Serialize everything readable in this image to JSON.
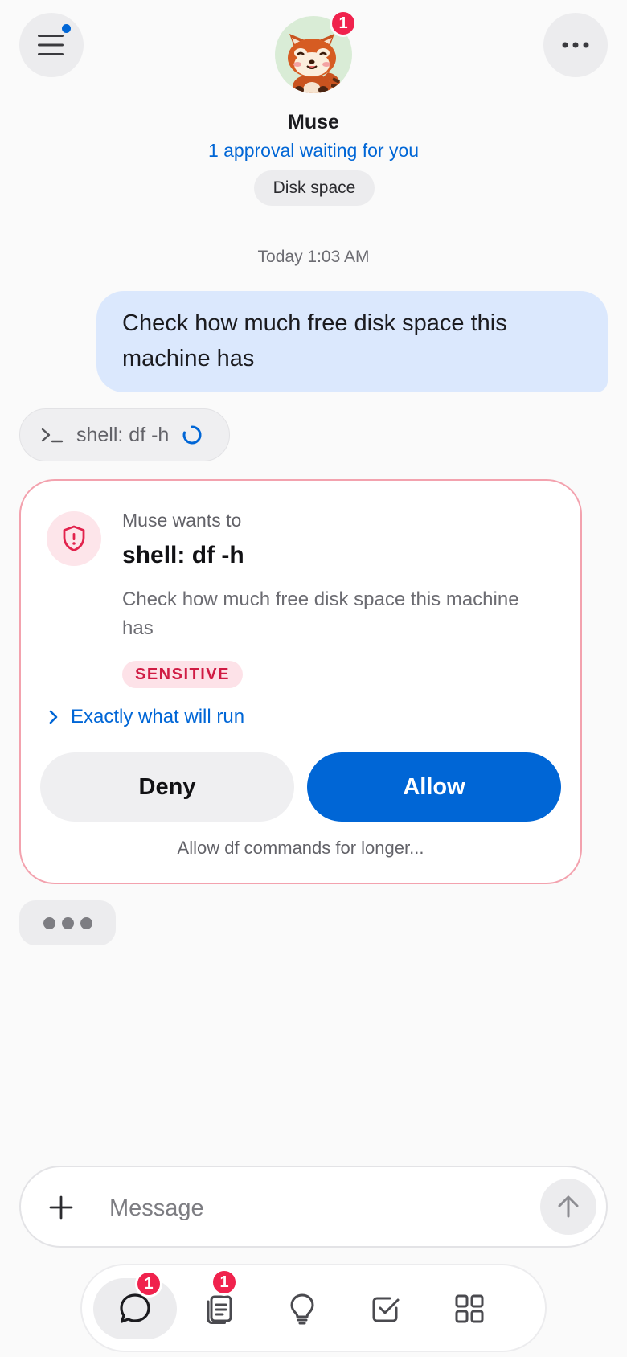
{
  "header": {
    "agent_name": "Muse",
    "status": "1 approval waiting for you",
    "topic_chip": "Disk space",
    "avatar_badge": "1"
  },
  "chat": {
    "timestamp": "Today 1:03 AM",
    "user_message": "Check how much free disk space this machine has",
    "tool_call": "shell: df -h"
  },
  "approval": {
    "intro": "Muse wants to",
    "command": "shell: df -h",
    "description": "Check how much free disk space this machine has",
    "tag": "SENSITIVE",
    "details_link": "Exactly what will run",
    "deny_label": "Deny",
    "allow_label": "Allow",
    "extend_label": "Allow df commands for longer..."
  },
  "composer": {
    "placeholder": "Message"
  },
  "tabs": {
    "chat_badge": "1",
    "docs_badge": "1"
  },
  "colors": {
    "accent": "#0066d6",
    "danger": "#f0224d",
    "user_bubble": "#dbe8fd"
  }
}
